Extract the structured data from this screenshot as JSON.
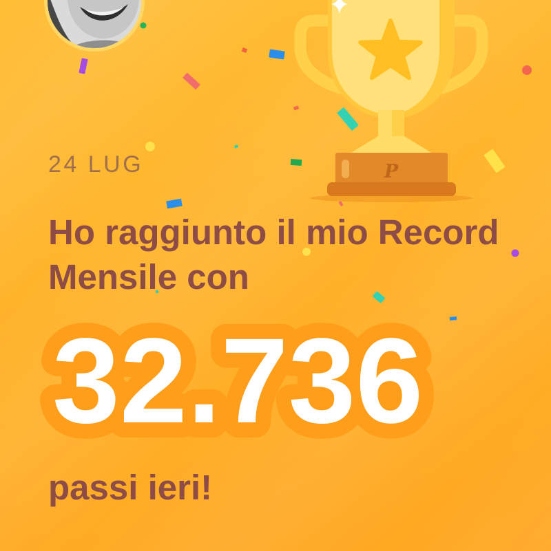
{
  "share_card": {
    "date": "24 LUG",
    "headline": "Ho raggiunto il mio Record Mensile con",
    "step_count": "32.736",
    "subtitle": "passi ieri!"
  },
  "trophy": {
    "logo_text": "P"
  },
  "icons": {
    "avatar": "user-avatar",
    "trophy": "trophy-icon",
    "emblem": "star-icon",
    "sparkle": "sparkle-icon",
    "decoration": "confetti"
  },
  "colors": {
    "background_top": "#FFBE35",
    "background_bottom": "#FFA620",
    "headline_text": "#8E4C46",
    "date_text": "#A0704C",
    "number_fill": "#FFFFFF",
    "number_outline": "#FF9E1A",
    "trophy_gold": "#FFD04A",
    "trophy_base": "#E2892A"
  }
}
